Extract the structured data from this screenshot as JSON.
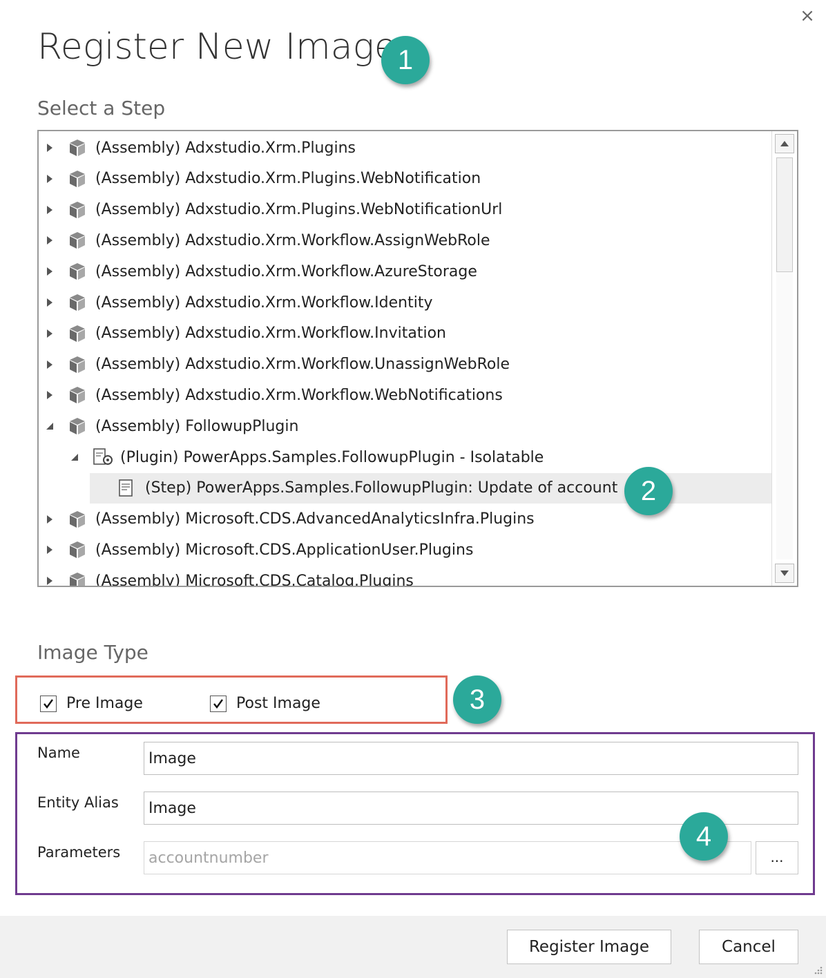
{
  "dialog": {
    "title": "Register New Image",
    "close_glyph": "×"
  },
  "callouts": [
    "1",
    "2",
    "3",
    "4"
  ],
  "step_section": {
    "label": "Select a Step",
    "rows": [
      {
        "text": "(Assembly) Adxstudio.Xrm.Plugins",
        "kind": "assembly",
        "expanded": false,
        "level": 0
      },
      {
        "text": "(Assembly) Adxstudio.Xrm.Plugins.WebNotification",
        "kind": "assembly",
        "expanded": false,
        "level": 0
      },
      {
        "text": "(Assembly) Adxstudio.Xrm.Plugins.WebNotificationUrl",
        "kind": "assembly",
        "expanded": false,
        "level": 0
      },
      {
        "text": "(Assembly) Adxstudio.Xrm.Workflow.AssignWebRole",
        "kind": "assembly",
        "expanded": false,
        "level": 0
      },
      {
        "text": "(Assembly) Adxstudio.Xrm.Workflow.AzureStorage",
        "kind": "assembly",
        "expanded": false,
        "level": 0
      },
      {
        "text": "(Assembly) Adxstudio.Xrm.Workflow.Identity",
        "kind": "assembly",
        "expanded": false,
        "level": 0
      },
      {
        "text": "(Assembly) Adxstudio.Xrm.Workflow.Invitation",
        "kind": "assembly",
        "expanded": false,
        "level": 0
      },
      {
        "text": "(Assembly) Adxstudio.Xrm.Workflow.UnassignWebRole",
        "kind": "assembly",
        "expanded": false,
        "level": 0
      },
      {
        "text": "(Assembly) Adxstudio.Xrm.Workflow.WebNotifications",
        "kind": "assembly",
        "expanded": false,
        "level": 0
      },
      {
        "text": "(Assembly) FollowupPlugin",
        "kind": "assembly",
        "expanded": true,
        "level": 0
      },
      {
        "text": "(Plugin) PowerApps.Samples.FollowupPlugin - Isolatable",
        "kind": "plugin",
        "expanded": true,
        "level": 1
      },
      {
        "text": "(Step) PowerApps.Samples.FollowupPlugin: Update of account",
        "kind": "step",
        "expanded": null,
        "level": 2,
        "selected": true
      },
      {
        "text": "(Assembly) Microsoft.CDS.AdvancedAnalyticsInfra.Plugins",
        "kind": "assembly",
        "expanded": false,
        "level": 0
      },
      {
        "text": "(Assembly) Microsoft.CDS.ApplicationUser.Plugins",
        "kind": "assembly",
        "expanded": false,
        "level": 0
      },
      {
        "text": "(Assembly) Microsoft.CDS.Catalog.Plugins",
        "kind": "assembly",
        "expanded": false,
        "level": 0
      }
    ]
  },
  "image_type": {
    "label": "Image Type",
    "pre_image": {
      "label": "Pre Image",
      "checked": true
    },
    "post_image": {
      "label": "Post Image",
      "checked": true
    }
  },
  "fields": {
    "name": {
      "label": "Name",
      "value": "Image"
    },
    "entity_alias": {
      "label": "Entity Alias",
      "value": "Image"
    },
    "parameters": {
      "label": "Parameters",
      "value": "accountnumber",
      "button_label": "..."
    }
  },
  "footer": {
    "register_label": "Register Image",
    "cancel_label": "Cancel"
  },
  "colors": {
    "callout": "#2ba99a",
    "highlight_red": "#e06a5a",
    "highlight_purple": "#6f3b8f",
    "selected_row": "#ececec"
  }
}
